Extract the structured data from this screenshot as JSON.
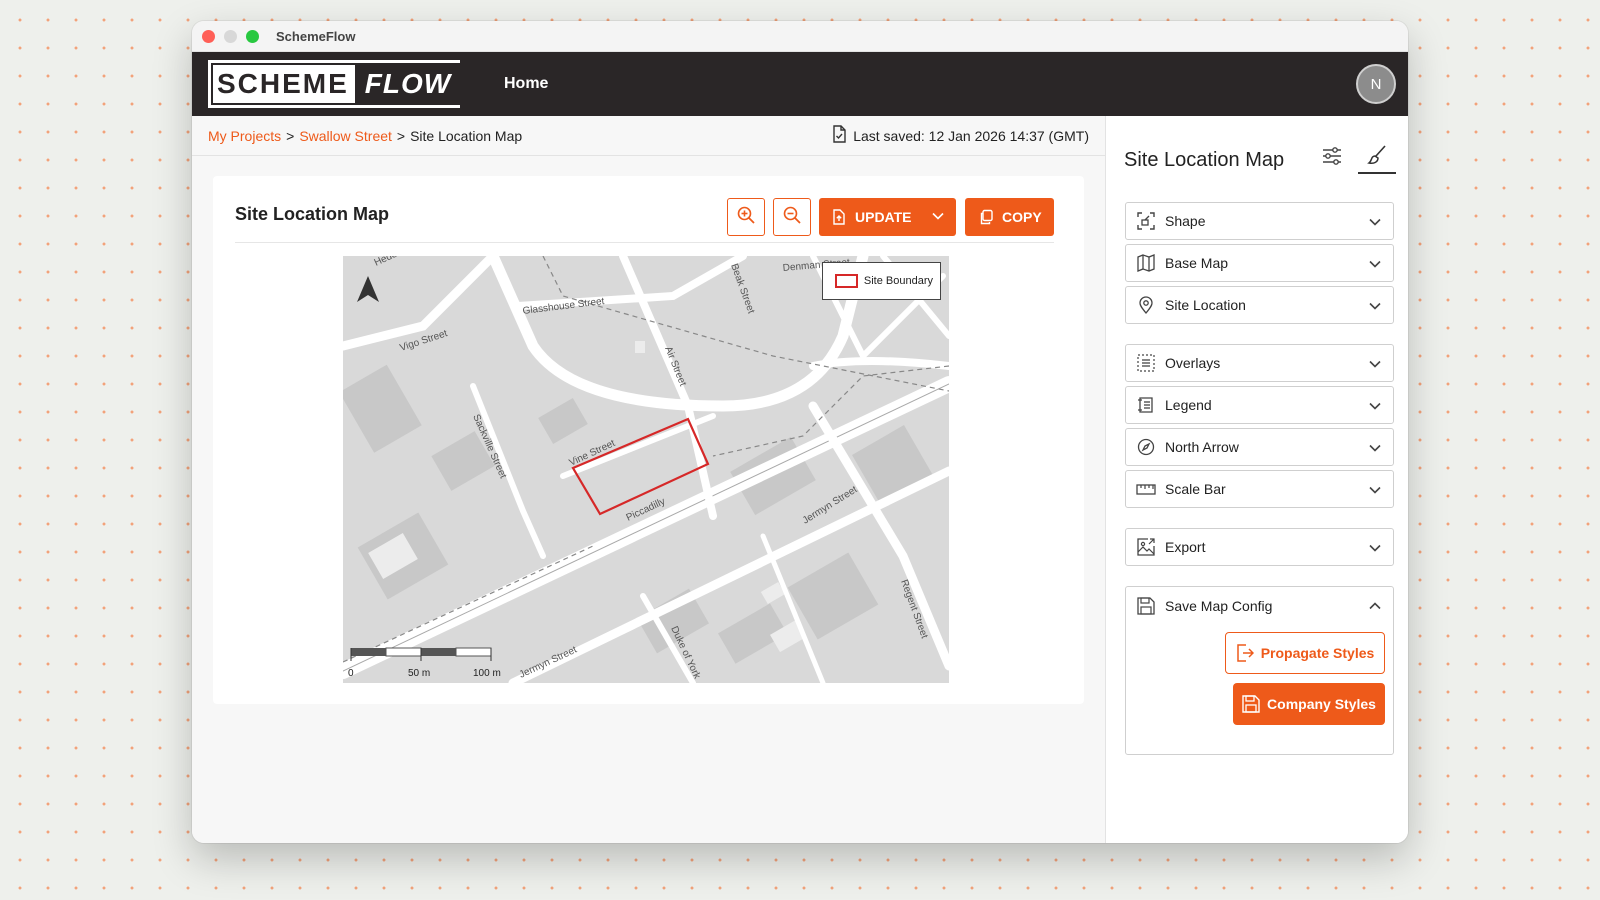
{
  "window": {
    "title": "SchemeFlow"
  },
  "appbar": {
    "logo_left": "SCHEME",
    "logo_right": "FLOW",
    "home_label": "Home",
    "avatar_initial": "N"
  },
  "breadcrumb": {
    "items": [
      "My Projects",
      "Swallow Street",
      "Site Location Map"
    ],
    "separator": ">"
  },
  "last_saved": "Last saved: 12 Jan 2026 14:37 (GMT)",
  "card": {
    "title": "Site Location Map",
    "update_label": "UPDATE",
    "copy_label": "COPY"
  },
  "map": {
    "legend_label": "Site Boundary",
    "streets": [
      "Glasshouse Street",
      "Denman Street",
      "Vigo Street",
      "Air Street",
      "Sackville Street",
      "Vine Street",
      "Piccadilly",
      "Jermyn Street",
      "Jermyn Street",
      "Duke of York",
      "Regent Street",
      "Heddon Street",
      "Beak Street"
    ],
    "scale": {
      "labels": [
        "0",
        "50 m",
        "100 m"
      ]
    }
  },
  "panel": {
    "title": "Site Location Map",
    "sections": [
      {
        "label": "Shape",
        "icon": "shape-icon"
      },
      {
        "label": "Base Map",
        "icon": "map-icon"
      },
      {
        "label": "Site Location",
        "icon": "location-pin-icon"
      },
      {
        "label": "Overlays",
        "icon": "overlays-icon"
      },
      {
        "label": "Legend",
        "icon": "legend-icon"
      },
      {
        "label": "North Arrow",
        "icon": "compass-icon"
      },
      {
        "label": "Scale Bar",
        "icon": "ruler-icon"
      },
      {
        "label": "Export",
        "icon": "export-image-icon"
      }
    ],
    "save_config": {
      "label": "Save Map Config",
      "propagate_label": "Propagate Styles",
      "company_label": "Company Styles"
    }
  },
  "colors": {
    "accent": "#ee5a1a",
    "appbar": "#2a2627",
    "site_boundary": "#d62828"
  }
}
